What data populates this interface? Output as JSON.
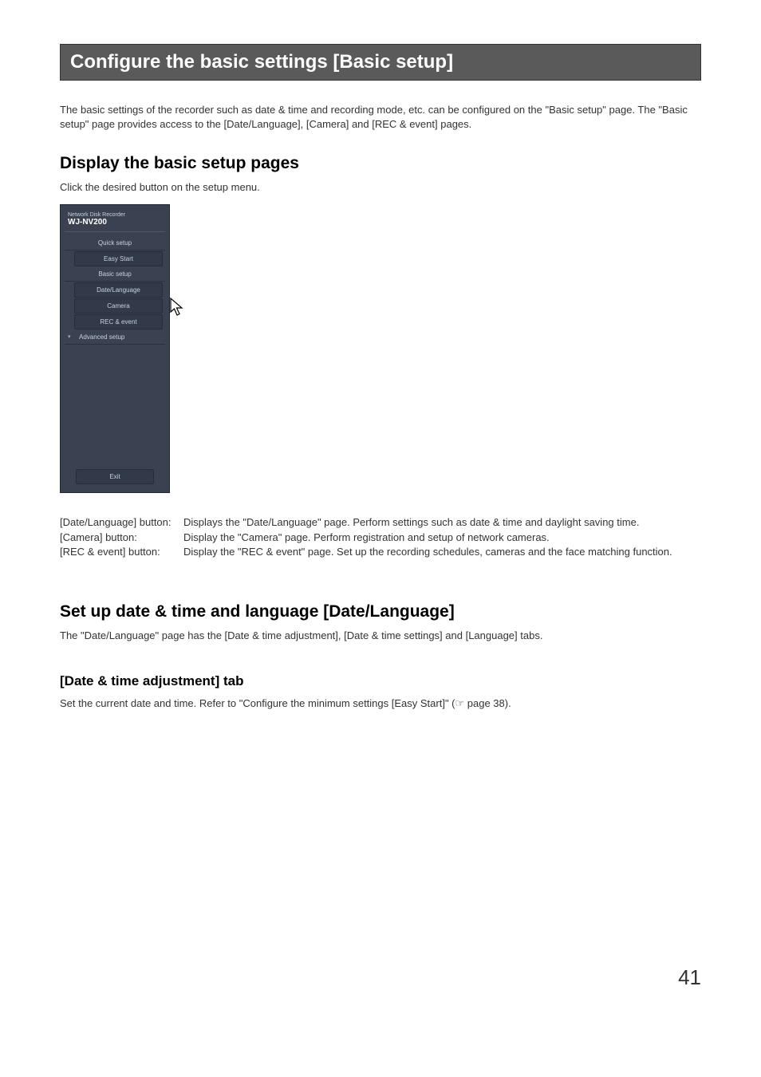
{
  "title": "Configure the basic settings [Basic setup]",
  "intro": "The basic settings of the recorder such as date & time and recording mode, etc. can be configured on the \"Basic setup\" page. The \"Basic setup\" page provides access to the [Date/Language], [Camera] and [REC & event] pages.",
  "section1": {
    "heading": "Display the basic setup pages",
    "text": "Click the desired button on the setup menu."
  },
  "device_ui": {
    "header": "Network Disk Recorder",
    "model": "WJ-NV200",
    "menu": {
      "quick_setup": "Quick setup",
      "easy_start": "Easy Start",
      "basic_setup": "Basic setup",
      "date_lang": "Date/Language",
      "camera": "Camera",
      "rec_event": "REC & event",
      "advanced": "Advanced setup",
      "exit": "Exit"
    }
  },
  "buttons": {
    "date_lang": {
      "label": "[Date/Language] button:",
      "desc": "Displays the \"Date/Language\" page. Perform settings such as date & time and daylight saving time."
    },
    "camera": {
      "label": "[Camera] button:",
      "desc": "Display the \"Camera\" page. Perform registration and setup of network cameras."
    },
    "rec_event": {
      "label": "[REC & event] button:",
      "desc": "Display the \"REC & event\" page. Set up the recording schedules, cameras and the face matching function."
    }
  },
  "section2": {
    "heading": "Set up date & time and language [Date/Language]",
    "text": "The \"Date/Language\" page has the [Date & time adjustment], [Date & time settings] and [Language] tabs."
  },
  "section3": {
    "heading": "[Date & time adjustment] tab",
    "text": "Set the current date and time. Refer to \"Configure the minimum settings [Easy Start]\" (☞ page 38)."
  },
  "page_number": "41"
}
